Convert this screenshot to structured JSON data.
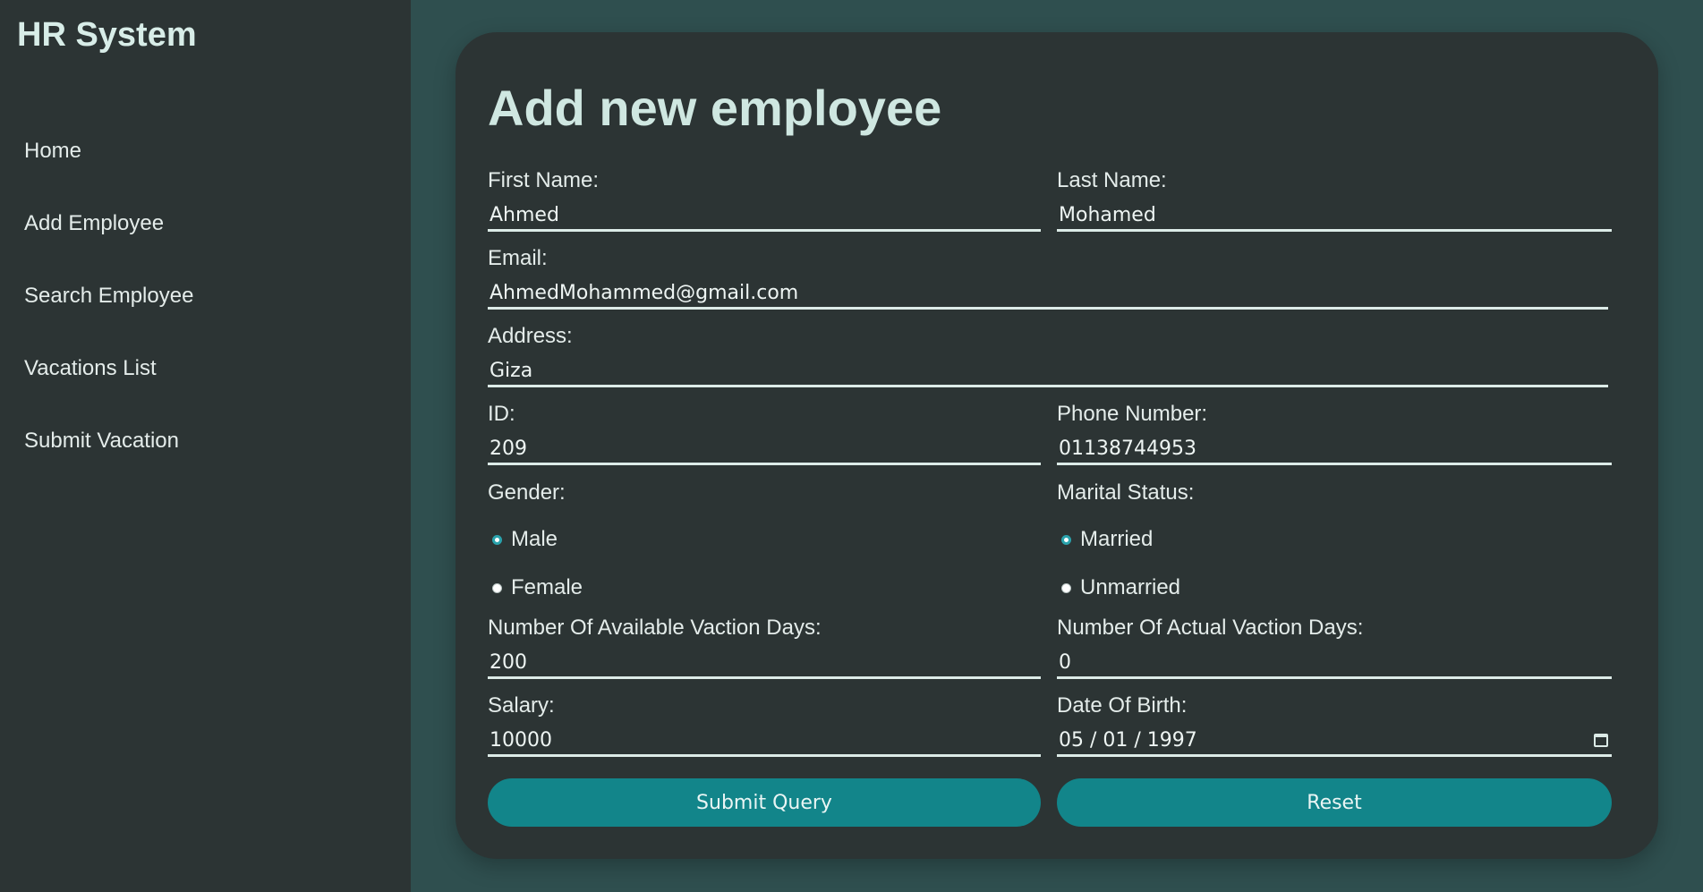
{
  "app": {
    "title": "HR System"
  },
  "nav": {
    "items": [
      {
        "label": "Home"
      },
      {
        "label": "Add Employee"
      },
      {
        "label": "Search Employee"
      },
      {
        "label": "Vacations List"
      },
      {
        "label": "Submit Vacation"
      }
    ]
  },
  "form": {
    "title": "Add new employee",
    "first_name": {
      "label": "First Name:",
      "value": "Ahmed"
    },
    "last_name": {
      "label": "Last Name:",
      "value": "Mohamed"
    },
    "email": {
      "label": "Email:",
      "value": "AhmedMohammed@gmail.com"
    },
    "address": {
      "label": "Address:",
      "value": "Giza"
    },
    "id": {
      "label": "ID:",
      "value": "209"
    },
    "phone": {
      "label": "Phone Number:",
      "value": "01138744953"
    },
    "gender": {
      "label": "Gender:",
      "options": [
        {
          "label": "Male",
          "checked": true
        },
        {
          "label": "Female",
          "checked": false
        }
      ]
    },
    "marital": {
      "label": "Marital Status:",
      "options": [
        {
          "label": "Married",
          "checked": true
        },
        {
          "label": "Unmarried",
          "checked": false
        }
      ]
    },
    "available_days": {
      "label": "Number Of Available Vaction Days:",
      "value": "200"
    },
    "actual_days": {
      "label": "Number Of Actual Vaction Days:",
      "value": "0"
    },
    "salary": {
      "label": "Salary:",
      "value": "10000"
    },
    "dob": {
      "label": "Date Of Birth:",
      "value": "05 / 01 / 1997",
      "icon": "calendar-icon"
    },
    "submit_label": "Submit Query",
    "reset_label": "Reset"
  },
  "colors": {
    "page_bg": "#2f4f4f",
    "panel_bg": "#2c3434",
    "accent": "#12858a",
    "radio_checked": "#2aa3ad"
  }
}
